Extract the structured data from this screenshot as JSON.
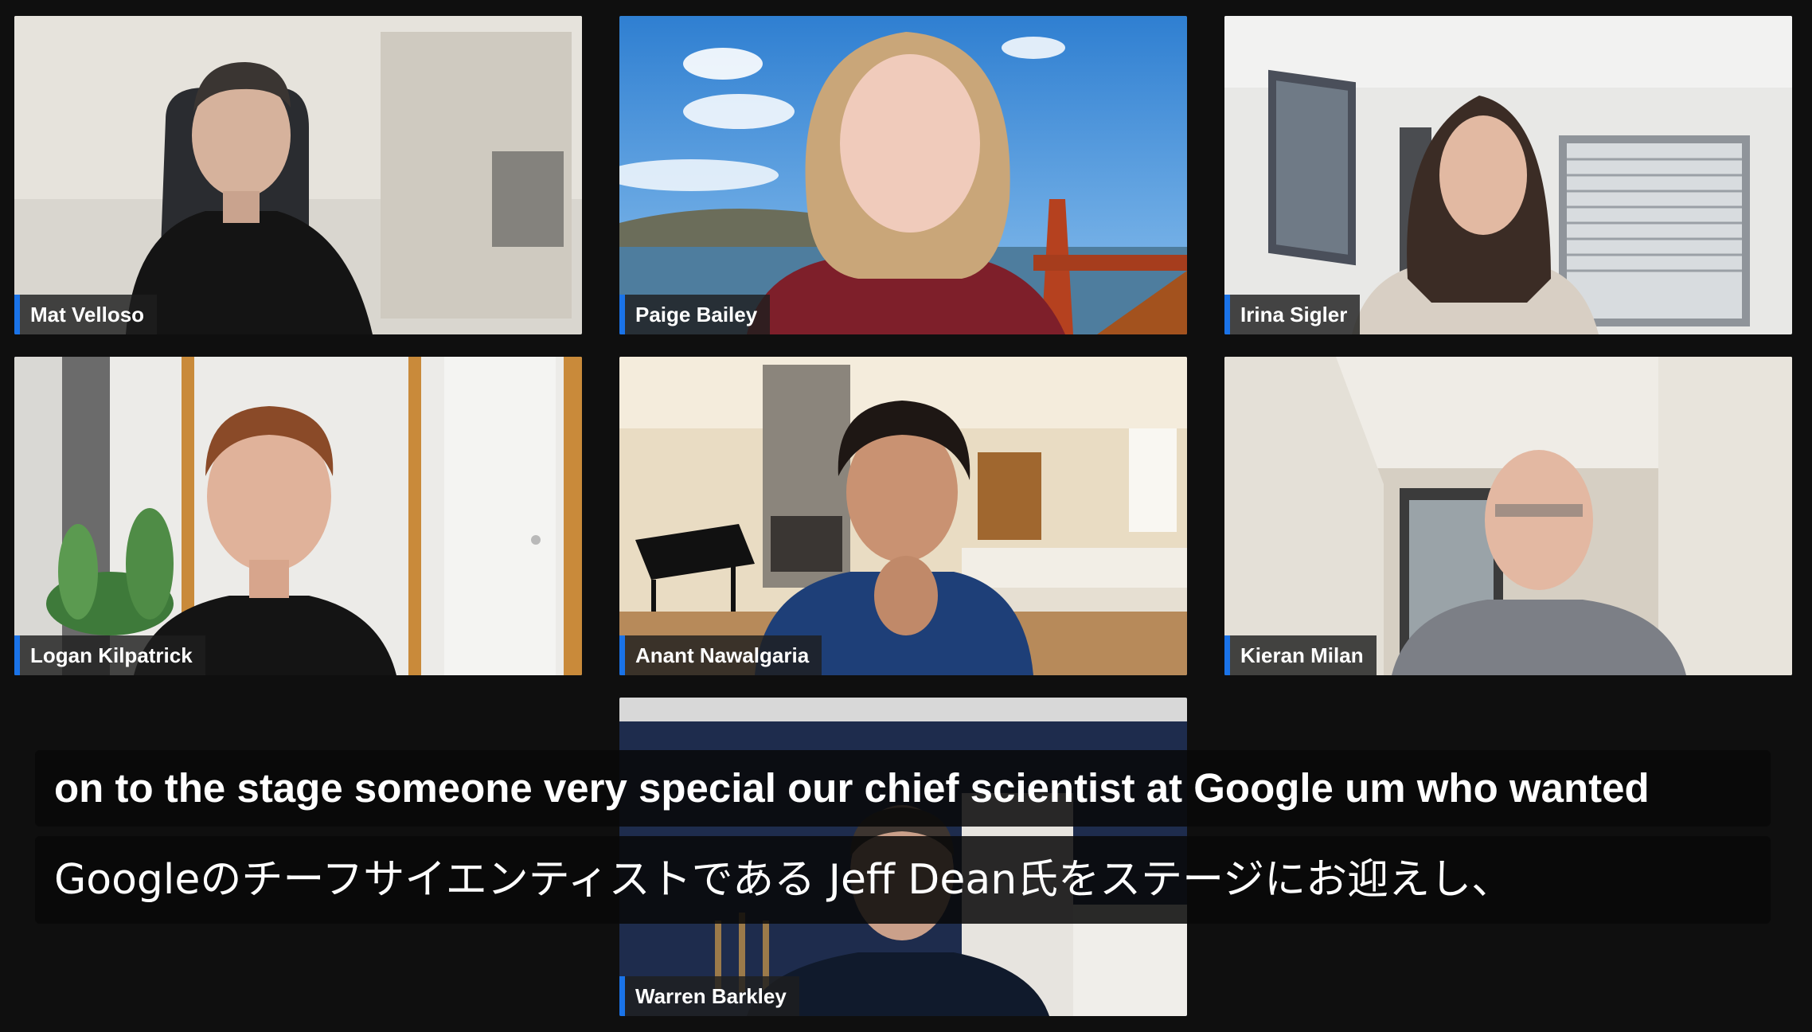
{
  "participants": [
    {
      "name": "Mat Velloso"
    },
    {
      "name": "Paige Bailey"
    },
    {
      "name": "Irina Sigler"
    },
    {
      "name": "Logan Kilpatrick"
    },
    {
      "name": "Anant Nawalgaria"
    },
    {
      "name": "Kieran Milan"
    },
    {
      "name": "Warren Barkley"
    }
  ],
  "captions": {
    "english": "on to the stage someone very special our chief scientist at Google um who wanted",
    "japanese": "Googleのチーフサイエンティストである Jeff Dean氏をステージにお迎えし、"
  },
  "colors": {
    "background": "#0f0f0f",
    "name_accent": "#1a73e8",
    "caption_bg": "#080808",
    "text": "#ffffff"
  }
}
